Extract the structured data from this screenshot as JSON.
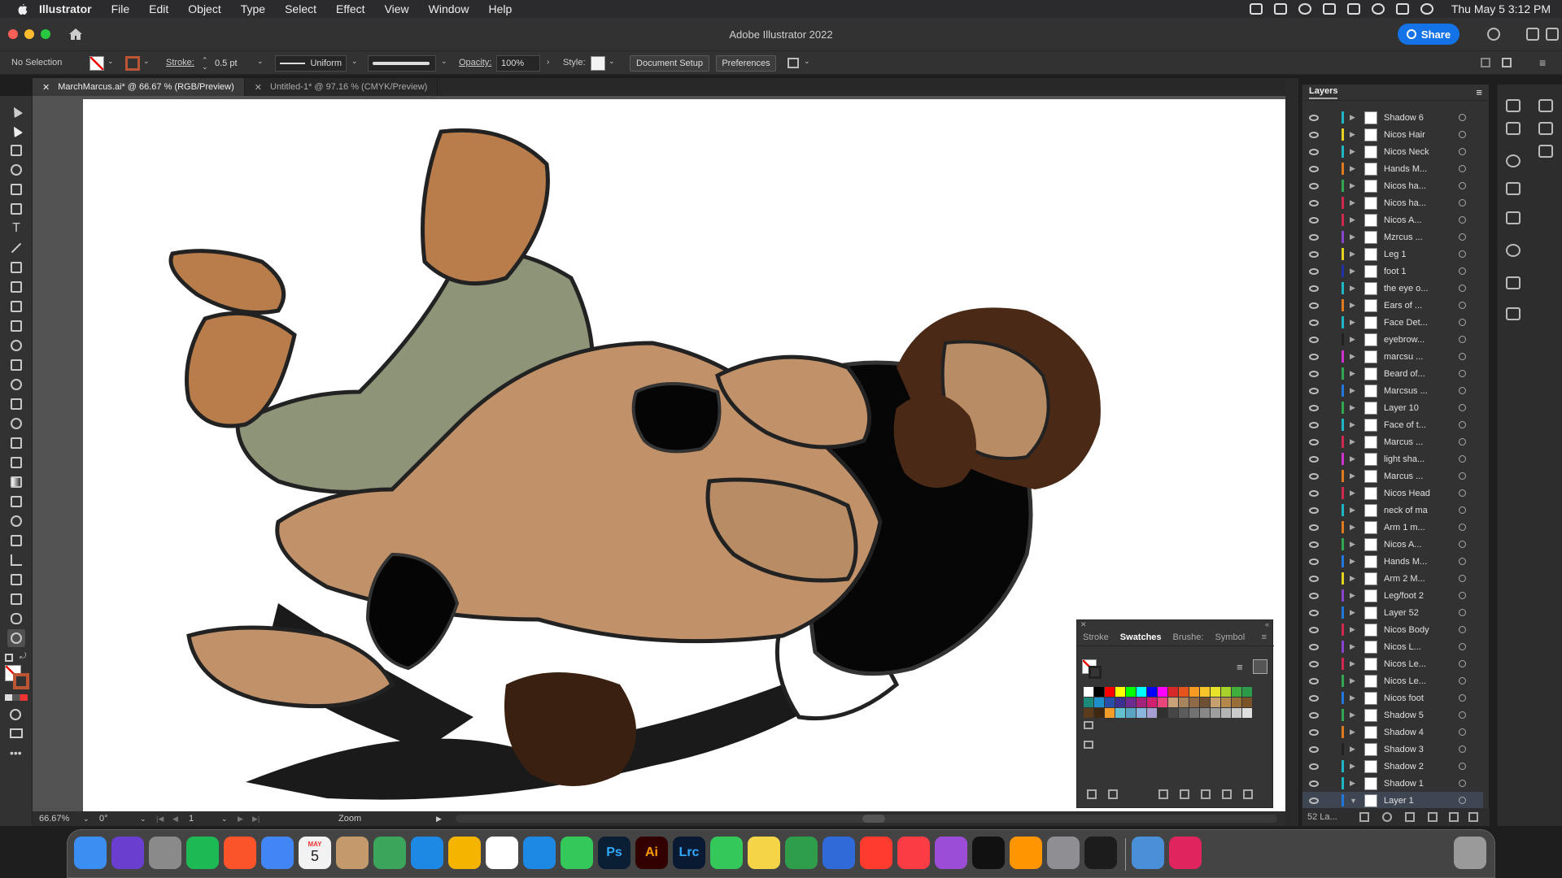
{
  "menubar": {
    "items": [
      "Illustrator",
      "File",
      "Edit",
      "Object",
      "Type",
      "Select",
      "Effect",
      "View",
      "Window",
      "Help"
    ],
    "clock": "Thu May 5  3:12 PM"
  },
  "titlebar": {
    "title": "Adobe Illustrator 2022",
    "share_label": "Share"
  },
  "controlbar": {
    "selection": "No Selection",
    "stroke_label": "Stroke:",
    "stroke_value": "0.5 pt",
    "profile": "Uniform",
    "opacity_label": "Opacity:",
    "opacity_value": "100%",
    "style_label": "Style:",
    "document_setup": "Document Setup",
    "preferences": "Preferences"
  },
  "tabs": [
    {
      "label": "MarchMarcus.ai* @ 66.67 % (RGB/Preview)"
    },
    {
      "label": "Untitled-1* @ 97.16 % (CMYK/Preview)"
    }
  ],
  "statusbar": {
    "zoom": "66.67%",
    "rotation": "0°",
    "artboard": "1",
    "tool": "Zoom"
  },
  "layers": {
    "title": "Layers",
    "count": "52 La...",
    "items": [
      {
        "name": "Shadow 6",
        "color": "#1fb5c6"
      },
      {
        "name": "Nicos Hair",
        "color": "#e6d021"
      },
      {
        "name": "Nicos Neck",
        "color": "#1fb5c6"
      },
      {
        "name": "Hands M...",
        "color": "#e07a1e"
      },
      {
        "name": "Nicos ha...",
        "color": "#32a852"
      },
      {
        "name": "Nicos ha...",
        "color": "#d02850"
      },
      {
        "name": "Nicos A...",
        "color": "#d02850"
      },
      {
        "name": "Mzrcus ...",
        "color": "#8844cc"
      },
      {
        "name": "Leg 1",
        "color": "#e6d021"
      },
      {
        "name": "foot 1",
        "color": "#2233aa"
      },
      {
        "name": "the eye o...",
        "color": "#1fb5c6"
      },
      {
        "name": "Ears of ...",
        "color": "#e07a1e"
      },
      {
        "name": "Face Det...",
        "color": "#1fb5c6"
      },
      {
        "name": "eyebrow...",
        "color": "#222222"
      },
      {
        "name": "marcsu ...",
        "color": "#cc33cc"
      },
      {
        "name": "Beard of...",
        "color": "#32a852"
      },
      {
        "name": "Marcsus ...",
        "color": "#2277dd"
      },
      {
        "name": "Layer 10",
        "color": "#32a852"
      },
      {
        "name": "Face of t...",
        "color": "#1fb5c6"
      },
      {
        "name": "Marcus ...",
        "color": "#d02850"
      },
      {
        "name": "light sha...",
        "color": "#cc33cc"
      },
      {
        "name": "Marcus ...",
        "color": "#e07a1e"
      },
      {
        "name": "Nicos Head",
        "color": "#d02850"
      },
      {
        "name": "neck of ma",
        "color": "#1fb5c6"
      },
      {
        "name": "Arm 1 m...",
        "color": "#e07a1e"
      },
      {
        "name": "Nicos A...",
        "color": "#32a852"
      },
      {
        "name": "Hands M...",
        "color": "#2277dd"
      },
      {
        "name": "Arm 2 M...",
        "color": "#e6d021"
      },
      {
        "name": "Leg/foot 2",
        "color": "#8844cc"
      },
      {
        "name": "Layer 52",
        "color": "#2277dd"
      },
      {
        "name": "Nicos Body",
        "color": "#d02850"
      },
      {
        "name": "Nicos L...",
        "color": "#8844cc"
      },
      {
        "name": "Nicos Le...",
        "color": "#d02850"
      },
      {
        "name": "Nicos Le...",
        "color": "#32a852"
      },
      {
        "name": "Nicos foot",
        "color": "#2277dd"
      },
      {
        "name": "Shadow 5",
        "color": "#32a852"
      },
      {
        "name": "Shadow 4",
        "color": "#e07a1e"
      },
      {
        "name": "Shadow 3",
        "color": "#222222"
      },
      {
        "name": "Shadow 2",
        "color": "#1fb5c6"
      },
      {
        "name": "Shadow 1",
        "color": "#1fb5c6"
      },
      {
        "name": "Layer 1",
        "color": "#2277dd"
      }
    ]
  },
  "swatches_panel": {
    "tabs": [
      "Stroke",
      "Swatches",
      "Brushe:",
      "Symbol"
    ],
    "colors": [
      "#ffffff",
      "#000000",
      "#ff0000",
      "#ffff00",
      "#00ff00",
      "#00ffff",
      "#0000ff",
      "#ff00ff",
      "#d62a2a",
      "#e6541e",
      "#f59a23",
      "#f7c52a",
      "#e8e22a",
      "#a6d22a",
      "#3fae3c",
      "#2b9a49",
      "#1b8a7a",
      "#1f8fc9",
      "#274fa8",
      "#3c2f8f",
      "#6c2c8f",
      "#a1237a",
      "#d1206f",
      "#e8467a",
      "#c9a27a",
      "#a8845e",
      "#8e6a48",
      "#6e5034",
      "#c7a070",
      "#b4884c",
      "#9a6e38",
      "#7a5428",
      "#5a3c1c",
      "#3e2812",
      "#f29d2a",
      "#62c0cf",
      "#5aa5c4",
      "#8ab5dc",
      "#a6a0d2",
      "#303030",
      "#464646",
      "#5c5c5c",
      "#727272",
      "#888888",
      "#9e9e9e",
      "#b4b4b4",
      "#cacaca",
      "#e0e0e0"
    ]
  },
  "dock": {
    "apps": [
      "Finder",
      "Siri",
      "Launchpad",
      "Spotify",
      "Brave",
      "Chrome",
      "Calendar",
      "Contacts",
      "Maps",
      "Safari",
      "Photos",
      "Reminders",
      "App Store",
      "Messages",
      "Ps",
      "Ai",
      "Lrc",
      "FaceTime",
      "Notes",
      "Numbers",
      "Keynote",
      "News",
      "Music",
      "Podcasts",
      "TV",
      "Books",
      "System Preferences",
      "Activity Monitor",
      "Preview",
      "Creative Cloud"
    ],
    "calendar_month": "MAY",
    "calendar_day": "5"
  }
}
